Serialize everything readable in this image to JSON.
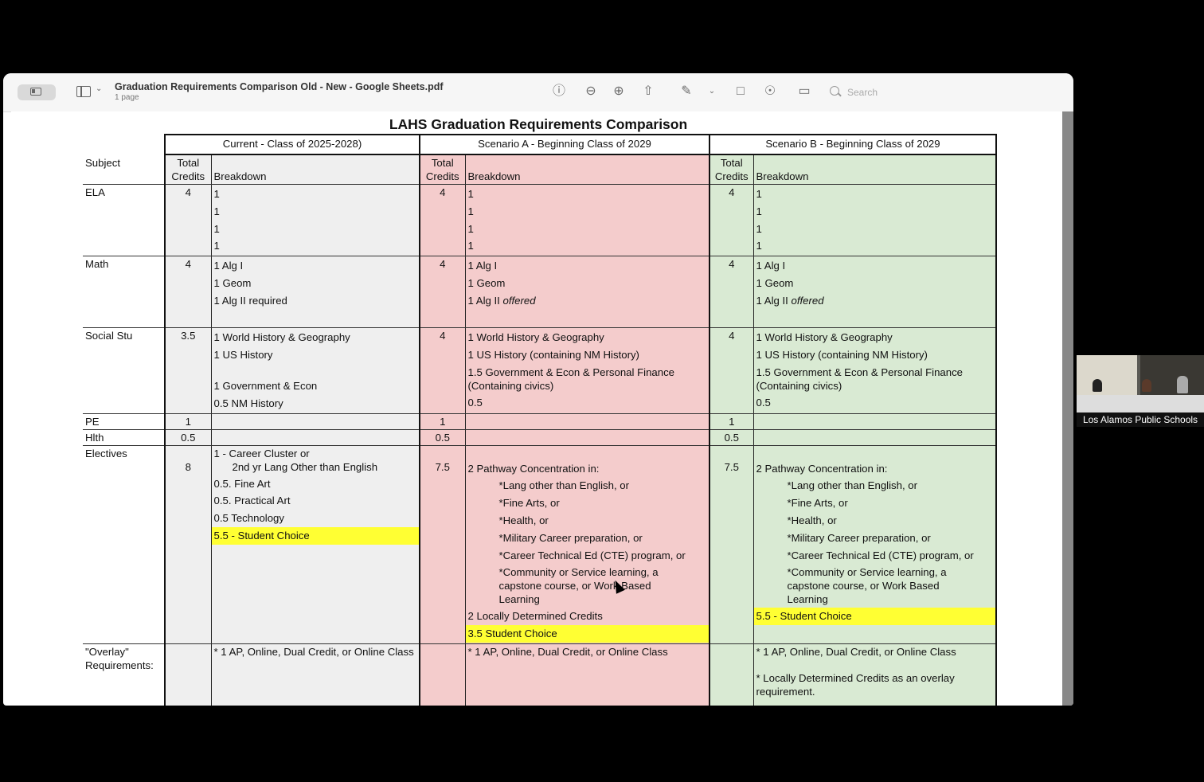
{
  "window": {
    "title": "Graduation Requirements Comparison Old - New - Google Sheets.pdf",
    "subtitle": "1 page",
    "search_placeholder": "Search"
  },
  "document": {
    "title": "LAHS Graduation Requirements Comparison",
    "headers": {
      "current": "Current - Class of 2025-2028)",
      "scenario_a": "Scenario A - Beginning Class of 2029",
      "scenario_b": "Scenario B - Beginning Class of 2029",
      "subject": "Subject",
      "total_credits": "Total Credits",
      "breakdown": "Breakdown"
    },
    "rows": {
      "ela": {
        "subject": "ELA",
        "cur_total": "4",
        "a_total": "4",
        "b_total": "4",
        "cur": [
          "1",
          "1",
          "1",
          "1"
        ],
        "a": [
          "1",
          "1",
          "1",
          "1"
        ],
        "b": [
          "1",
          "1",
          "1",
          "1"
        ]
      },
      "math": {
        "subject": "Math",
        "cur_total": "4",
        "a_total": "4",
        "b_total": "4",
        "cur": [
          "1 Alg I",
          "1 Geom",
          "1 Alg II required"
        ],
        "a": [
          "1 Alg I",
          "1 Geom",
          "1 Alg II ",
          "offered"
        ],
        "b": [
          "1 Alg I",
          "1 Geom",
          "1 Alg II ",
          "offered"
        ]
      },
      "social": {
        "subject": "Social Stu",
        "cur_total": "3.5",
        "a_total": "4",
        "b_total": "4",
        "cur": [
          "1 World History & Geography",
          "1 US History",
          "1 Government & Econ",
          "0.5 NM History"
        ],
        "a": [
          "1 World History & Geography",
          "1 US History (containing NM History)",
          "1.5 Government & Econ & Personal Finance (Containing civics)",
          "0.5"
        ],
        "b": [
          "1 World History & Geography",
          "1 US History (containing NM History)",
          "1.5 Government & Econ & Personal Finance (Containing civics)",
          "0.5"
        ]
      },
      "pe": {
        "subject": "PE",
        "cur_total": "1",
        "a_total": "1",
        "b_total": "1"
      },
      "hlth": {
        "subject": "Hlth",
        "cur_total": "0.5",
        "a_total": "0.5",
        "b_total": "0.5"
      },
      "electives": {
        "subject": "Electives",
        "cur_total": "8",
        "a_total": "7.5",
        "b_total": "7.5",
        "cur": [
          "1 - Career Cluster or",
          "2nd yr Lang Other than English",
          "0.5. Fine Art",
          "0.5. Practical Art",
          "0.5  Technology",
          "5.5 - Student Choice"
        ],
        "a_intro": "2 Pathway Concentration in:",
        "pathways": [
          "*Lang other than English, or",
          "*Fine Arts, or",
          "*Health, or",
          "*Military Career preparation, or",
          "*Career Technical Ed (CTE) program, or",
          "*Community or Service learning, a capstone course, or Work Based Learning"
        ],
        "a_extra": "2 Locally Determined Credits",
        "a_choice": "3.5 Student Choice",
        "b_intro": "2 Pathway Concentration in:",
        "b_choice": "5.5 - Student Choice"
      },
      "overlay": {
        "subject": "\"Overlay\" Requirements:",
        "cur": "* 1 AP, Online, Dual Credit, or Online Class",
        "a": "* 1 AP, Online, Dual Credit, or Online Class",
        "b1": "* 1 AP, Online, Dual Credit, or Online Class",
        "b2": "* Locally Determined Credits as an overlay requirement."
      }
    }
  },
  "video": {
    "caption": "Los Alamos Public Schools"
  },
  "colors": {
    "current": "#efefef",
    "scenario_a": "#f4cccc",
    "scenario_b": "#d9ead3",
    "highlight": "#ffff33"
  }
}
